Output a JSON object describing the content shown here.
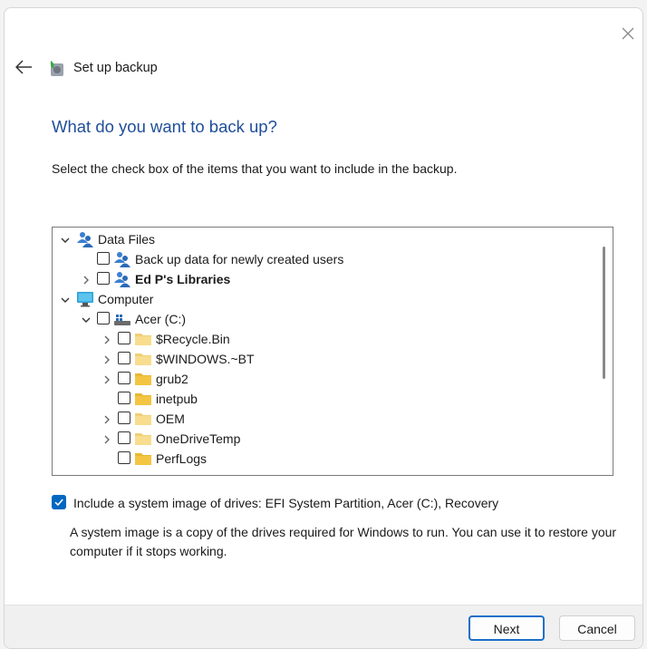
{
  "window": {
    "title": "Set up backup",
    "close_icon": "close-icon",
    "back_icon": "back-arrow-icon"
  },
  "page": {
    "heading": "What do you want to back up?",
    "instruction": "Select the check box of the items that you want to include in the backup."
  },
  "tree": {
    "items": [
      {
        "label": "Data Files",
        "chevron": "down",
        "checkbox": false,
        "icon": "users-icon",
        "bold": false
      },
      {
        "label": "Back up data for newly created users",
        "chevron": "none",
        "checkbox": true,
        "checked": false,
        "icon": "users-icon",
        "bold": false
      },
      {
        "label": "Ed P's Libraries",
        "chevron": "right",
        "checkbox": true,
        "checked": false,
        "icon": "users-icon",
        "bold": true
      },
      {
        "label": "Computer",
        "chevron": "down",
        "checkbox": false,
        "icon": "computer-icon",
        "bold": false
      },
      {
        "label": "Acer (C:)",
        "chevron": "down",
        "checkbox": true,
        "checked": false,
        "icon": "drive-icon",
        "bold": false
      },
      {
        "label": "$Recycle.Bin",
        "chevron": "right",
        "checkbox": true,
        "checked": false,
        "icon": "folder-light-icon",
        "bold": false
      },
      {
        "label": "$WINDOWS.~BT",
        "chevron": "right",
        "checkbox": true,
        "checked": false,
        "icon": "folder-light-icon",
        "bold": false
      },
      {
        "label": "grub2",
        "chevron": "right",
        "checkbox": true,
        "checked": false,
        "icon": "folder-icon",
        "bold": false
      },
      {
        "label": "inetpub",
        "chevron": "none",
        "checkbox": true,
        "checked": false,
        "icon": "folder-icon",
        "bold": false
      },
      {
        "label": "OEM",
        "chevron": "right",
        "checkbox": true,
        "checked": false,
        "icon": "folder-light-icon",
        "bold": false
      },
      {
        "label": "OneDriveTemp",
        "chevron": "right",
        "checkbox": true,
        "checked": false,
        "icon": "folder-light-icon",
        "bold": false
      },
      {
        "label": "PerfLogs",
        "chevron": "none",
        "checkbox": true,
        "checked": false,
        "icon": "folder-icon",
        "bold": false
      }
    ]
  },
  "system_image": {
    "checked": true,
    "label": "Include a system image of drives: EFI System Partition, Acer (C:), Recovery",
    "description": "A system image is a copy of the drives required for Windows to run. You can use it to restore your computer if it stops working."
  },
  "buttons": {
    "next": "Next",
    "cancel": "Cancel"
  },
  "colors": {
    "accent": "#0067c0",
    "heading": "#1f4e99",
    "folder": "#f4c542",
    "folder_light": "#f8dd8e"
  }
}
